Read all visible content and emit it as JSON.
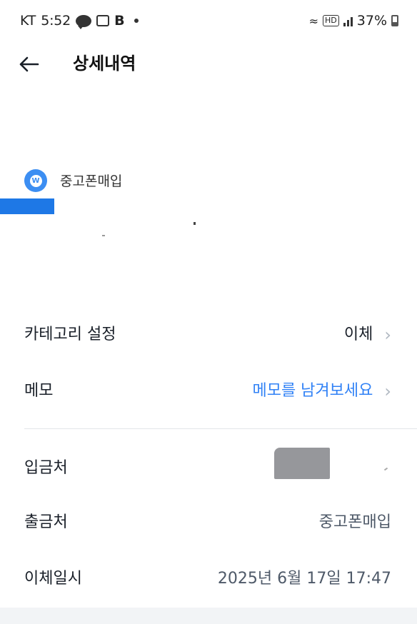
{
  "status_bar": {
    "carrier": "KT",
    "time": "5:52",
    "battery": "37%",
    "battery_level": 0.37,
    "icons": [
      "kakaotalk-icon",
      "box-app-icon",
      "b-app-icon",
      "dot-icon",
      "wifi-icon",
      "hd-icon",
      "signal-icon",
      "battery-icon"
    ]
  },
  "header": {
    "back_icon": "arrow-left-icon",
    "title": "상세내역"
  },
  "transaction": {
    "merchant_icon": "won-coin-icon",
    "merchant": "중고폰매입",
    "accent_color": "#3c8ef2"
  },
  "settings": {
    "category": {
      "label": "카테고리 설정",
      "value": "이체"
    },
    "memo": {
      "label": "메모",
      "value": "메모를 남겨보세요",
      "value_color": "#3182f6"
    }
  },
  "details": {
    "deposit_to": {
      "label": "입금처"
    },
    "withdraw_from": {
      "label": "출금처",
      "value": "중고폰매입"
    },
    "transfer_datetime": {
      "label": "이체일시",
      "value": "2025년 6월 17일 17:47"
    }
  }
}
